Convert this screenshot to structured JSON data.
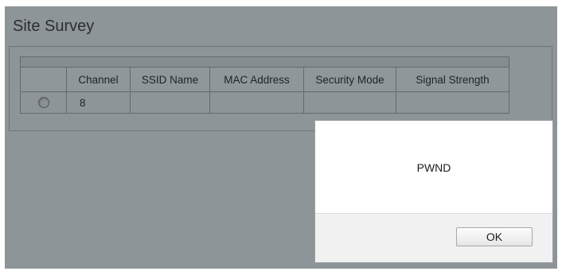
{
  "page": {
    "title": "Site Survey"
  },
  "survey_table": {
    "columns": [
      "",
      "Channel",
      "SSID Name",
      "MAC Address",
      "Security Mode",
      "Signal Strength"
    ],
    "rows": [
      {
        "selected": false,
        "channel": "8",
        "ssid": "",
        "mac": "",
        "security": "",
        "signal": ""
      }
    ]
  },
  "alert_dialog": {
    "message": "PWND",
    "ok_label": "OK"
  },
  "colors": {
    "overlay_background": "#8e9598",
    "dialog_background": "#ffffff",
    "dialog_footer": "#f1f1f1"
  }
}
